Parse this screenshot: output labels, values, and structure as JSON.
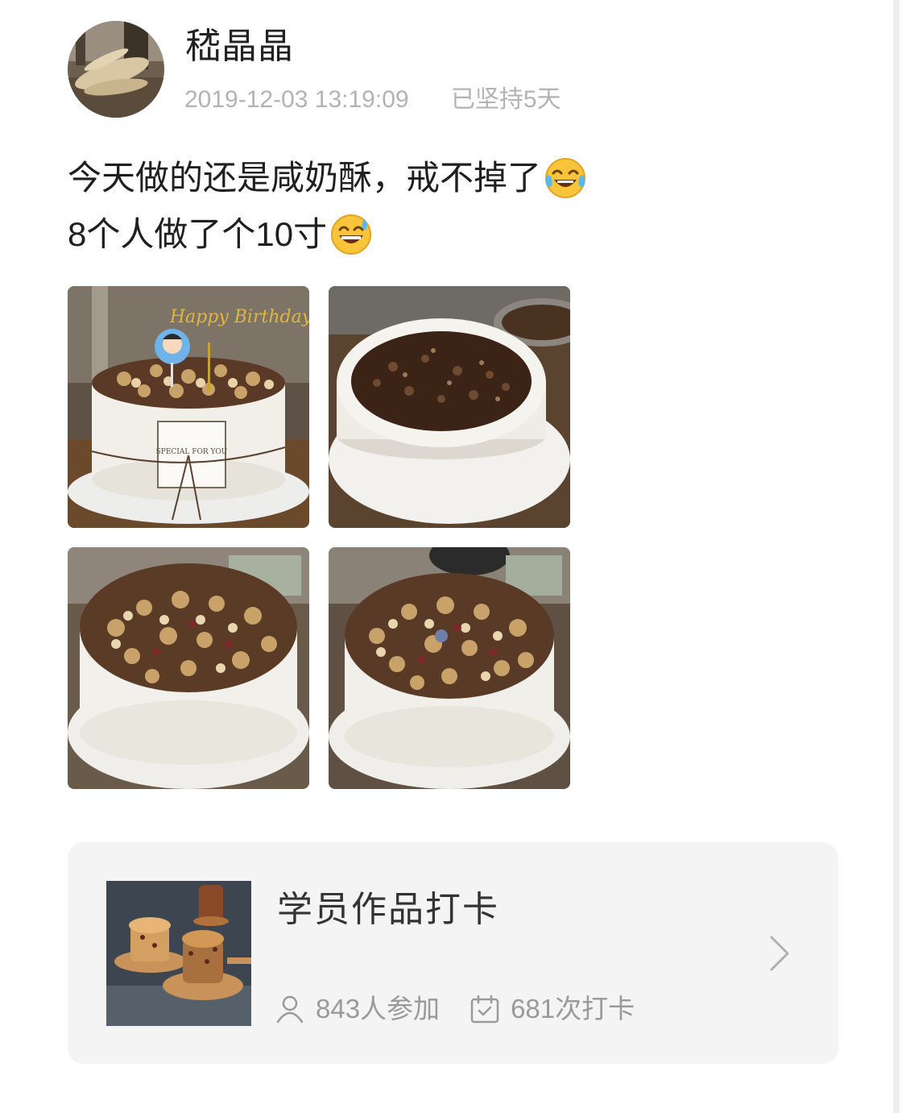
{
  "post": {
    "author_name": "嵇晶晶",
    "timestamp": "2019-12-03 13:19:09",
    "streak": "已坚持5天",
    "text_line1": "今天做的还是咸奶酥，戒不掉了",
    "text_line1_emoji": "tears-of-joy-emoji",
    "text_line2": "8个人做了个10寸",
    "text_line2_emoji": "grinning-sweat-emoji",
    "photos": [
      {
        "name": "cake-photo-birthday",
        "topper_text": "Happy Birthday",
        "label_text": "SPECIAL FOR YOU"
      },
      {
        "name": "cake-photo-chocolate"
      },
      {
        "name": "cake-photo-nuts-1"
      },
      {
        "name": "cake-photo-nuts-2"
      }
    ]
  },
  "activity_card": {
    "title": "学员作品打卡",
    "participants": "843人参加",
    "participants_icon": "person-icon",
    "checkins": "681次打卡",
    "checkins_icon": "calendar-check-icon",
    "chevron_icon": "chevron-right-icon"
  },
  "colors": {
    "text_primary": "#222222",
    "text_meta": "#b3b3b3",
    "card_background": "#f4f4f4",
    "card_stats": "#9a9a9a"
  }
}
